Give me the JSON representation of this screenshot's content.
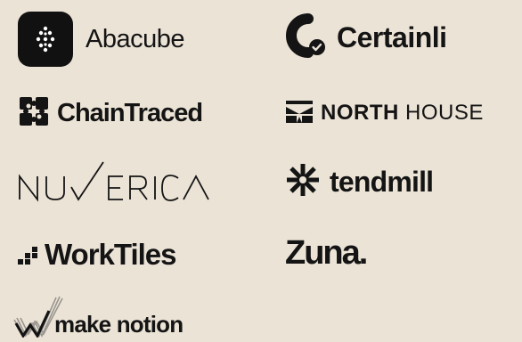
{
  "logos": {
    "abacube": {
      "name": "Abacube",
      "icon": "dotted-diamond-icon"
    },
    "certainli": {
      "name": "Certainli",
      "icon": "c-check-icon"
    },
    "chaintraced": {
      "name": "ChainTraced",
      "icon": "puzzle-cross-icon"
    },
    "northhouse": {
      "name_bold": "NORTH",
      "name_light": "HOUSE",
      "icon": "house-mark-icon"
    },
    "nuverica": {
      "name": "NUVERICA"
    },
    "tendmill": {
      "name": "tendmill",
      "icon": "asterisk-burst-icon"
    },
    "worktiles": {
      "name": "WorkTiles",
      "icon": "dot-steps-icon"
    },
    "zuna": {
      "name": "Zuna."
    },
    "makenotion": {
      "name": "make notion",
      "icon": "w-strokes-icon"
    }
  },
  "colors": {
    "background": "#ebe3d6",
    "ink": "#141414"
  }
}
